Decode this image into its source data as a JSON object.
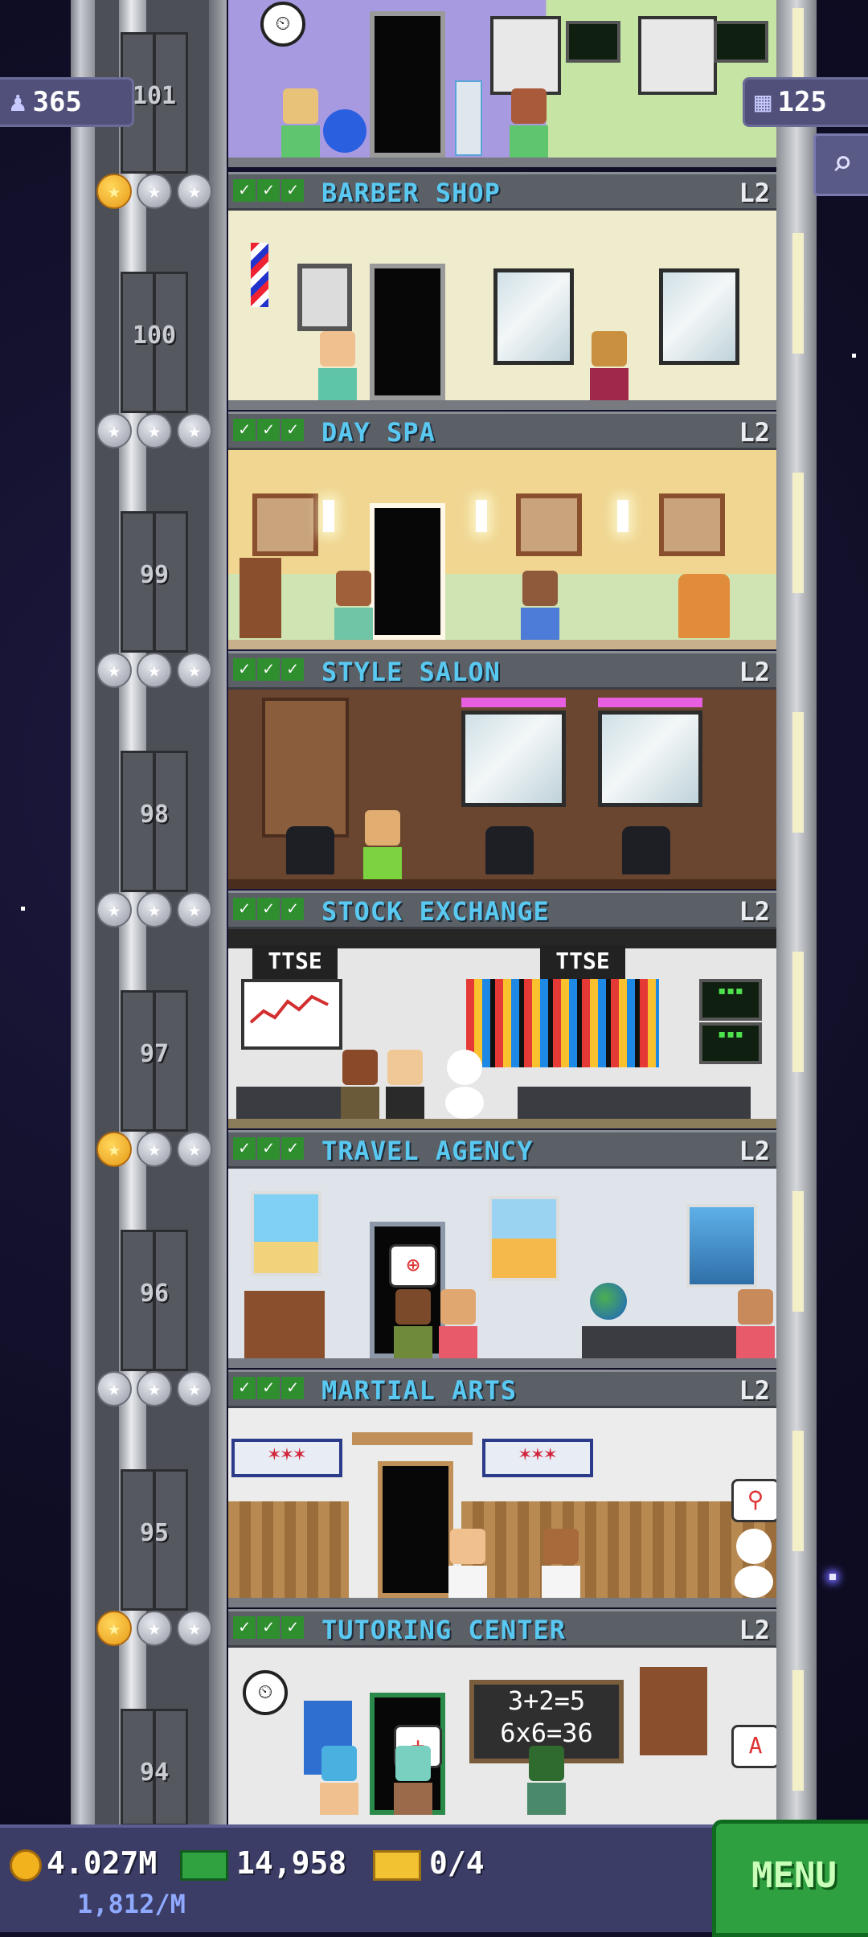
{
  "hud": {
    "population": "365",
    "floor_count": "125",
    "coins": "4.027M",
    "coin_rate": "1,812/M",
    "bux": "14,958",
    "tickets": "0/4",
    "menu_label": "MENU"
  },
  "elevator_floors": [
    "101",
    "100",
    "99",
    "98",
    "97",
    "96",
    "95",
    "94"
  ],
  "floors": [
    {
      "name": "BARBER SHOP",
      "level": "L2",
      "stars_gold": 1
    },
    {
      "name": "DAY SPA",
      "level": "L2",
      "stars_gold": 0
    },
    {
      "name": "STYLE SALON",
      "level": "L2",
      "stars_gold": 0
    },
    {
      "name": "STOCK EXCHANGE",
      "level": "L2",
      "stars_gold": 0
    },
    {
      "name": "TRAVEL AGENCY",
      "level": "L2",
      "stars_gold": 1
    },
    {
      "name": "MARTIAL ARTS",
      "level": "L2",
      "stars_gold": 0
    },
    {
      "name": "TUTORING CENTER",
      "level": "L2",
      "stars_gold": 1
    }
  ],
  "signs": {
    "ticker_left": "TTSE",
    "ticker_right": "TTSE",
    "chalk_line1": "3+2=5",
    "chalk_line2": "6x6=36"
  },
  "colors": {
    "floor_name": "#59c9f2",
    "menu_green": "#2fa040",
    "hud_bar": "#3b3d66"
  },
  "icons": [
    "person-icon",
    "building-icon",
    "search-icon",
    "coin-icon",
    "bux-icon",
    "ticket-icon",
    "star-icon",
    "check-icon"
  ]
}
